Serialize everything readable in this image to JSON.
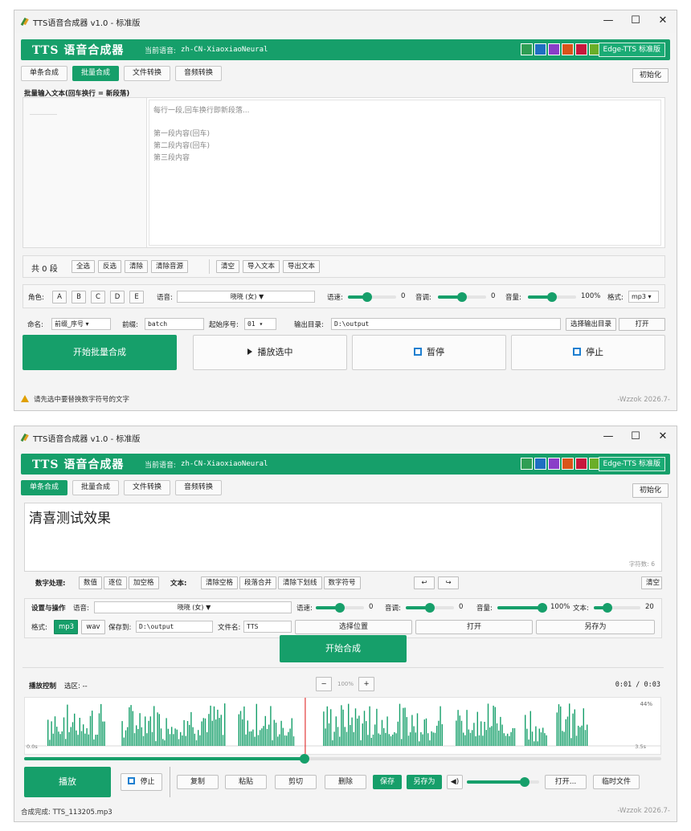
{
  "w1": {
    "titlebar": {
      "title": "TTS语音合成器 v1.0 - 标准版"
    },
    "header": {
      "app_title": "TTS 语音合成器",
      "voice_label": "当前语音:",
      "voice_value": "zh-CN-XiaoxiaoNeural",
      "edition": "Edge-TTS 标准版",
      "swatches": [
        "#2f9e54",
        "#1f6fc2",
        "#8a3ec8",
        "#d9541a",
        "#c8183c",
        "#6aae28"
      ]
    },
    "tabs": [
      {
        "label": "单条合成",
        "active": false
      },
      {
        "label": "批量合成",
        "active": true
      },
      {
        "label": "文件转换",
        "active": false
      },
      {
        "label": "音频转换",
        "active": false
      }
    ],
    "init_button": "初始化",
    "batch_label": "批量输入文本(回车换行 = 新段落)",
    "textarea": {
      "placeholder_hint": "每行一段,回车换行即新段落...",
      "lines": [
        "第一段内容(回车)",
        "第二段内容(回车)",
        "第三段内容"
      ]
    },
    "count_label": "共 0 段",
    "toolbar_buttons": [
      "全选",
      "反选",
      "清除",
      "清除音源"
    ],
    "toolbar_buttons2": [
      "清空",
      "导入文本",
      "导出文本"
    ],
    "roles": {
      "label": "角色:",
      "items": [
        "A",
        "B",
        "C",
        "D",
        "E"
      ]
    },
    "voice": {
      "label": "语音:",
      "value": "晓晓 (女) ▼"
    },
    "rate": {
      "label": "语速:",
      "value": "0",
      "fraction": 0.4
    },
    "pitch": {
      "label": "音调:",
      "value": "0",
      "fraction": 0.5
    },
    "volume": {
      "label": "音量:",
      "value": "100%",
      "fraction": 0.5
    },
    "format": {
      "label": "格式:",
      "value": "mp3 ▾"
    },
    "naming": {
      "label": "命名:",
      "value": "前缀_序号 ▾"
    },
    "prefix": {
      "label": "前缀:",
      "value": "batch"
    },
    "start_no": {
      "label": "起始序号:",
      "value": "01 ▾"
    },
    "output_dir": {
      "label": "输出目录:",
      "value": "D:\\output"
    },
    "choose_dir_button": "选择输出目录",
    "open_button": "打开",
    "start_batch": "开始批量合成",
    "play_selected": "播放选中",
    "pause": "暂停",
    "stop": "停止",
    "status": "请先选中要替换数字符号的文字",
    "signature": "-Wzzok 2026.7-"
  },
  "w2": {
    "titlebar": {
      "title": "TTS语音合成器 v1.0 - 标准版"
    },
    "header": {
      "app_title": "TTS 语音合成器",
      "voice_label": "当前语音:",
      "voice_value": "zh-CN-XiaoxiaoNeural",
      "edition": "Edge-TTS 标准版",
      "swatches": [
        "#2f9e54",
        "#1f6fc2",
        "#8a3ec8",
        "#d9541a",
        "#c8183c",
        "#6aae28"
      ]
    },
    "tabs": [
      {
        "label": "单条合成",
        "active": true
      },
      {
        "label": "批量合成",
        "active": false
      },
      {
        "label": "文件转换",
        "active": false
      },
      {
        "label": "音频转换",
        "active": false
      }
    ],
    "init_button": "初始化",
    "text_content": "清喜测试效果",
    "char_count": "字符数: 6",
    "number_proc": {
      "label": "数字处理:",
      "buttons": [
        "数值",
        "逐位",
        "加空格"
      ]
    },
    "text_ops": {
      "label": "文本:",
      "buttons": [
        "清除空格",
        "段落合并",
        "清除下划线",
        "数字符号"
      ]
    },
    "undo": "↩",
    "redo": "↪",
    "clear": "清空",
    "settings_label": "设置与操作",
    "voice": {
      "label": "语音:",
      "value": "晓晓 (女) ▼"
    },
    "rate": {
      "label": "语速:",
      "value": "0",
      "fraction": 0.5
    },
    "pitch": {
      "label": "音调:",
      "value": "0",
      "fraction": 0.5
    },
    "volume": {
      "label": "音量:",
      "value": "100%",
      "fraction": 1.0
    },
    "text_size": {
      "label": "文本:",
      "value": "20",
      "fraction": 0.3
    },
    "format": {
      "label": "格式:",
      "mp3": "mp3",
      "wav": "wav"
    },
    "save_to": {
      "label": "保存到:",
      "value": "D:\\output"
    },
    "file_name": {
      "label": "文件名:",
      "value": "TTS"
    },
    "choose_location": "选择位置",
    "open": "打开",
    "save_as": "另存为",
    "start": "开始合成",
    "playback": {
      "label": "播放控制",
      "selection": "选区: --",
      "zoom_minus": "−",
      "zoom": "100%",
      "zoom_plus": "+",
      "time": "0:01 / 0:03",
      "peak": "44%",
      "t_start": "0.0s",
      "t_end": "3.5s",
      "progress": 0.44
    },
    "controls": {
      "play": "播放",
      "stop": "停止",
      "copy": "复制",
      "paste": "粘贴",
      "cut": "剪切",
      "delete": "删除",
      "save": "保存",
      "save_as": "另存为",
      "volume_fraction": 0.8,
      "open": "打开...",
      "temp": "临时文件"
    },
    "status": "合成完成: TTS_113205.mp3",
    "signature": "-Wzzok 2026.7-"
  }
}
